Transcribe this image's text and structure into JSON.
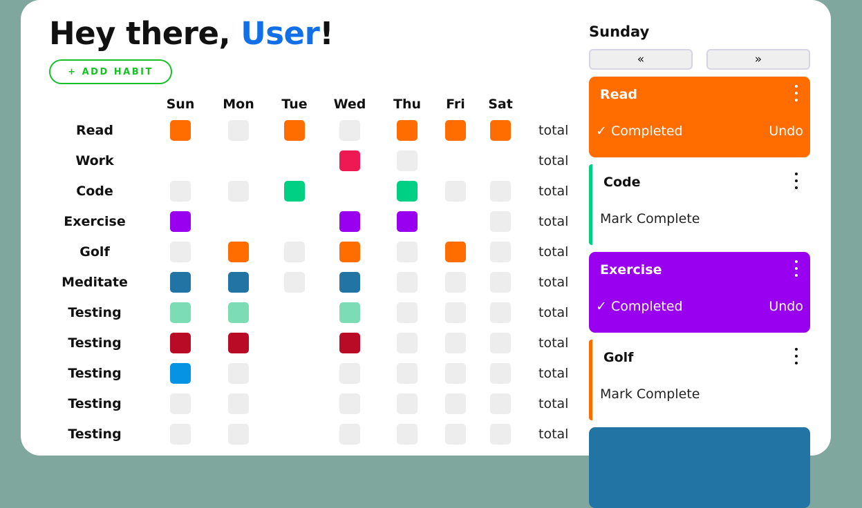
{
  "header": {
    "greeting": "Hey there, ",
    "user": "User",
    "exclaim": "!",
    "add_habit_label": "+ ADD HABIT"
  },
  "grid": {
    "days": [
      "Sun",
      "Mon",
      "Tue",
      "Wed",
      "Thu",
      "Fri",
      "Sat"
    ],
    "total_label": "total",
    "rows": [
      {
        "name": "Read",
        "color": "#ff6d00",
        "cells": [
          "done",
          "empty",
          "done",
          "empty",
          "done",
          "done",
          "done"
        ]
      },
      {
        "name": "Work",
        "color": "#ee1952",
        "cells": [
          "none",
          "none",
          "none",
          "done",
          "empty",
          "none",
          "none"
        ]
      },
      {
        "name": "Code",
        "color": "#00d084",
        "cells": [
          "empty",
          "empty",
          "done",
          "none",
          "done",
          "empty",
          "empty"
        ]
      },
      {
        "name": "Exercise",
        "color": "#9900ef",
        "cells": [
          "done",
          "none",
          "none",
          "done",
          "done",
          "none",
          "empty"
        ]
      },
      {
        "name": "Golf",
        "color": "#ff6d00",
        "cells": [
          "empty",
          "done",
          "empty",
          "done",
          "empty",
          "done",
          "empty"
        ]
      },
      {
        "name": "Meditate",
        "color": "#2274a5",
        "cells": [
          "done",
          "done",
          "empty",
          "done",
          "empty",
          "empty",
          "empty"
        ]
      },
      {
        "name": "Testing",
        "color": "#7bdcb5",
        "cells": [
          "done",
          "done",
          "none",
          "done",
          "empty",
          "empty",
          "empty"
        ]
      },
      {
        "name": "Testing",
        "color": "#b90b26",
        "cells": [
          "done",
          "done",
          "none",
          "done",
          "empty",
          "empty",
          "empty"
        ]
      },
      {
        "name": "Testing",
        "color": "#0693e3",
        "cells": [
          "done",
          "empty",
          "none",
          "empty",
          "empty",
          "empty",
          "empty"
        ]
      },
      {
        "name": "Testing",
        "color": "#ff6d00",
        "cells": [
          "empty",
          "empty",
          "none",
          "empty",
          "empty",
          "empty",
          "empty"
        ]
      },
      {
        "name": "Testing",
        "color": "#ff6d00",
        "cells": [
          "empty",
          "empty",
          "none",
          "empty",
          "empty",
          "empty",
          "empty"
        ]
      }
    ]
  },
  "sidebar": {
    "day": "Sunday",
    "prev_label": "«",
    "next_label": "»",
    "cards": [
      {
        "name": "Read",
        "state": "done",
        "color": "#ff6d00",
        "status": "✓ Completed",
        "action": "Undo"
      },
      {
        "name": "Code",
        "state": "todo",
        "color": "#00d084",
        "status": "Mark Complete",
        "action": ""
      },
      {
        "name": "Exercise",
        "state": "done",
        "color": "#9900ef",
        "status": "✓ Completed",
        "action": "Undo"
      },
      {
        "name": "Golf",
        "state": "todo",
        "color": "#ff6d00",
        "status": "Mark Complete",
        "action": ""
      },
      {
        "name": "",
        "state": "done",
        "color": "#2274a5",
        "status": "",
        "action": ""
      }
    ]
  }
}
